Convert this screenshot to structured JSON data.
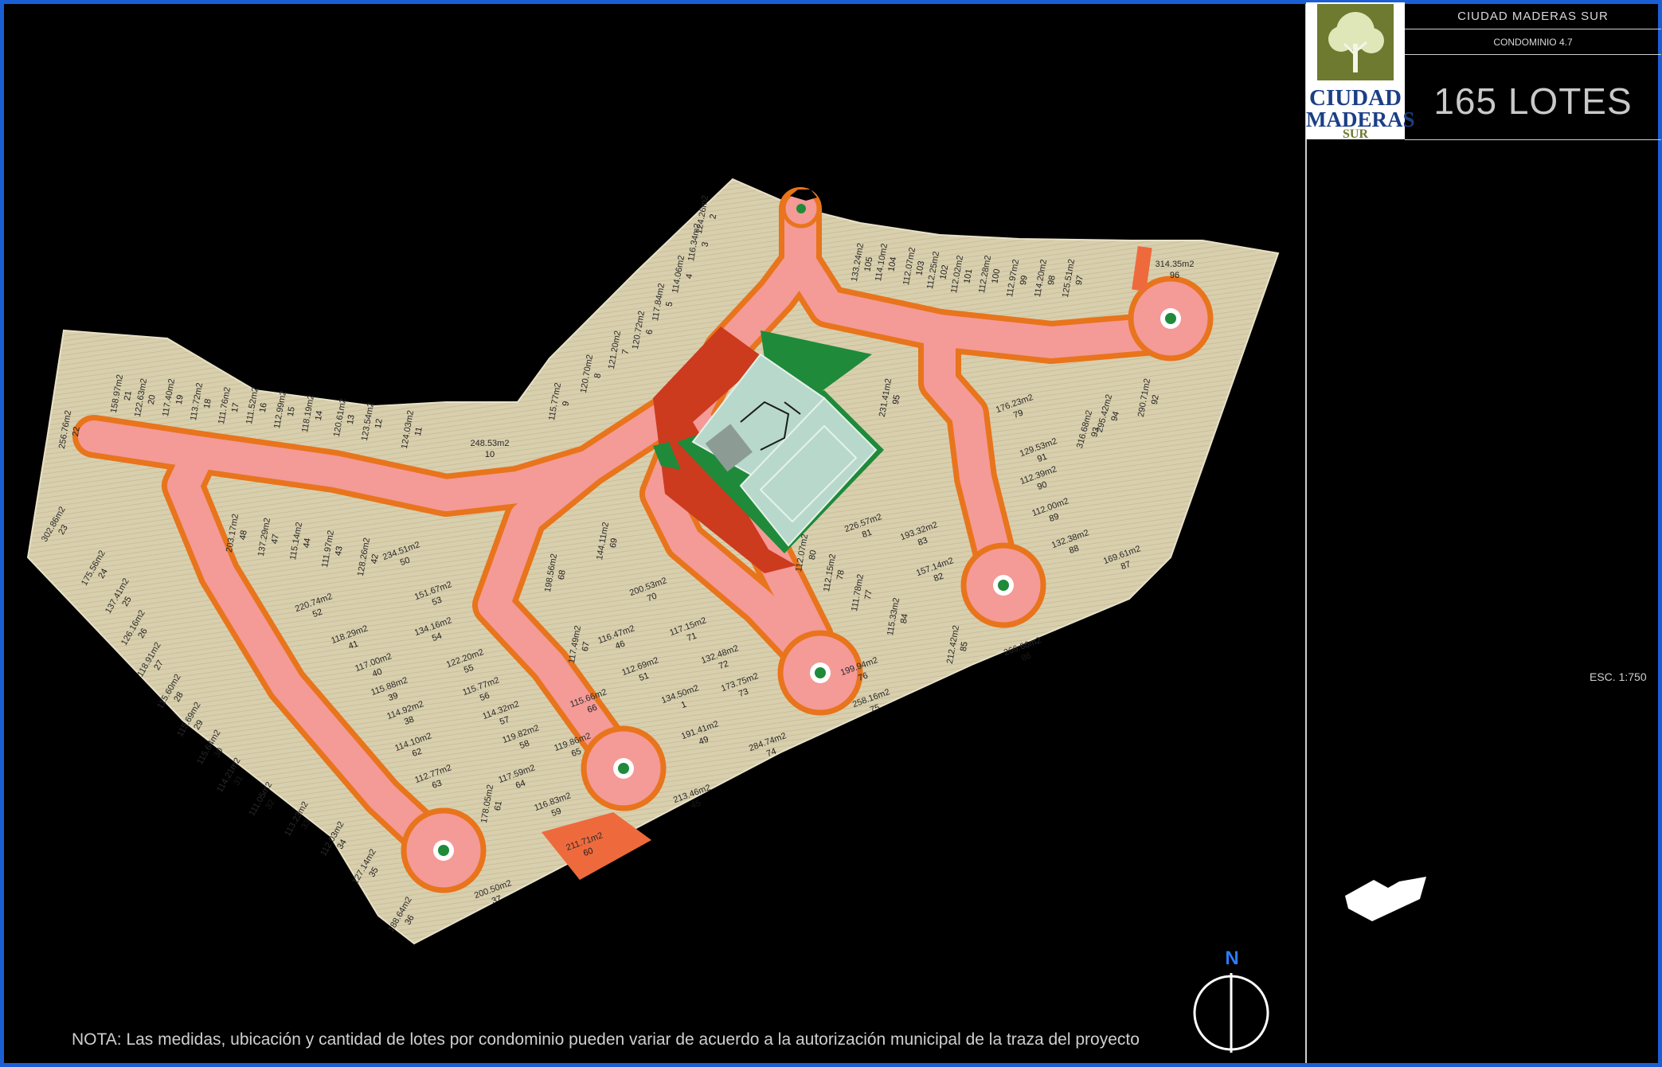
{
  "header": {
    "development_name": "CIUDAD MADERAS SUR",
    "condominium": "CONDOMINIO 4.7",
    "lot_count_label": "165 LOTES"
  },
  "logo": {
    "line1": "CIUDAD",
    "line2": "MADERAS",
    "line3": "SUR"
  },
  "scale_label": "ESC. 1:750",
  "north_label": "N",
  "note": "NOTA: Las medidas, ubicación y cantidad de lotes por condominio pueden variar de acuerdo a la autorización municipal de la traza del proyecto",
  "colors": {
    "background": "#000000",
    "frame": "#1b5fd6",
    "lot_fill": "#d8cfae",
    "road_fill": "#f49a97",
    "road_edge": "#e8741c",
    "green_area": "#1f8a3a",
    "amenity": "#b8d8cc",
    "commercial": "#cc3b1e",
    "special_lot": "#ee6a3c"
  },
  "lots": [
    {
      "number": "10",
      "area": "248.53m2"
    },
    {
      "number": "94",
      "area": "295.42m2"
    },
    {
      "number": "96",
      "area": "314.35m2"
    },
    {
      "number": "60",
      "area": "211.71m2"
    },
    {
      "number": "36",
      "area": "188.64m2"
    },
    {
      "number": "37",
      "area": "200.50m2"
    },
    {
      "number": "75",
      "area": "258.16m2"
    },
    {
      "number": "86",
      "area": "266.66m2"
    },
    {
      "number": "22",
      "area": "256.76m2"
    },
    {
      "number": "93",
      "area": "316.68m2"
    },
    {
      "number": "79",
      "area": "176.23m2"
    },
    {
      "number": "105",
      "area": "133.24m2"
    },
    {
      "number": "104",
      "area": "114.10m2"
    },
    {
      "number": "103",
      "area": "112.07m2"
    },
    {
      "number": "102",
      "area": "112.25m2"
    },
    {
      "number": "101",
      "area": "112.02m2"
    },
    {
      "number": "100",
      "area": "112.28m2"
    },
    {
      "number": "99",
      "area": "112.97m2"
    },
    {
      "number": "98",
      "area": "114.20m2"
    },
    {
      "number": "97",
      "area": "125.51m2"
    },
    {
      "number": "21",
      "area": "158.97m2"
    },
    {
      "number": "20",
      "area": "122.63m2"
    },
    {
      "number": "19",
      "area": "117.40m2"
    },
    {
      "number": "18",
      "area": "113.72m2"
    },
    {
      "number": "17",
      "area": "111.76m2"
    },
    {
      "number": "16",
      "area": "111.52m2"
    },
    {
      "number": "15",
      "area": "112.99m2"
    },
    {
      "number": "14",
      "area": "118.19m2"
    },
    {
      "number": "13",
      "area": "120.61m2"
    },
    {
      "number": "12",
      "area": "123.54m2"
    },
    {
      "number": "11",
      "area": "124.03m2"
    },
    {
      "number": "2",
      "area": "124.26m2"
    },
    {
      "number": "3",
      "area": "116.34m2"
    },
    {
      "number": "4",
      "area": "114.06m2"
    },
    {
      "number": "5",
      "area": "117.84m2"
    },
    {
      "number": "6",
      "area": "120.72m2"
    },
    {
      "number": "7",
      "area": "121.20m2"
    },
    {
      "number": "8",
      "area": "120.70m2"
    },
    {
      "number": "9",
      "area": "115.77m2"
    },
    {
      "number": "48",
      "area": "203.17m2"
    },
    {
      "number": "47",
      "area": "137.29m2"
    },
    {
      "number": "50",
      "area": "234.51m2"
    },
    {
      "number": "52",
      "area": "220.74m2"
    },
    {
      "number": "53",
      "area": "151.67m2"
    },
    {
      "number": "54",
      "area": "134.16m2"
    },
    {
      "number": "55",
      "area": "122.20m2"
    },
    {
      "number": "56",
      "area": "115.77m2"
    },
    {
      "number": "57",
      "area": "114.32m2"
    },
    {
      "number": "58",
      "area": "119.82m2"
    },
    {
      "number": "59",
      "area": "116.83m2"
    },
    {
      "number": "23",
      "area": "302.86m2"
    },
    {
      "number": "24",
      "area": "175.56m2"
    },
    {
      "number": "25",
      "area": "137.41m2"
    },
    {
      "number": "26",
      "area": "126.16m2"
    },
    {
      "number": "27",
      "area": "118.91m2"
    },
    {
      "number": "28",
      "area": "115.60m2"
    },
    {
      "number": "29",
      "area": "115.69m2"
    },
    {
      "number": "30",
      "area": "115.64m2"
    },
    {
      "number": "31",
      "area": "114.21m2"
    },
    {
      "number": "32",
      "area": "111.05m2"
    },
    {
      "number": "33",
      "area": "113.23m2"
    },
    {
      "number": "34",
      "area": "112.03m2"
    },
    {
      "number": "35",
      "area": "127.14m2"
    },
    {
      "number": "44",
      "area": "115.14m2"
    },
    {
      "number": "43",
      "area": "111.97m2"
    },
    {
      "number": "42",
      "area": "128.26m2"
    },
    {
      "number": "41",
      "area": "118.29m2"
    },
    {
      "number": "40",
      "area": "117.00m2"
    },
    {
      "number": "39",
      "area": "115.88m2"
    },
    {
      "number": "38",
      "area": "114.92m2"
    },
    {
      "number": "61",
      "area": "178.05m2"
    },
    {
      "number": "62",
      "area": "114.10m2"
    },
    {
      "number": "63",
      "area": "112.77m2"
    },
    {
      "number": "64",
      "area": "117.59m2"
    },
    {
      "number": "65",
      "area": "119.86m2"
    },
    {
      "number": "66",
      "area": "115.66m2"
    },
    {
      "number": "67",
      "area": "117.49m2"
    },
    {
      "number": "68",
      "area": "198.56m2"
    },
    {
      "number": "69",
      "area": "144.11m2"
    },
    {
      "number": "70",
      "area": "200.53m2"
    },
    {
      "number": "71",
      "area": "117.15m2"
    },
    {
      "number": "72",
      "area": "132.48m2"
    },
    {
      "number": "73",
      "area": "173.75m2"
    },
    {
      "number": "74",
      "area": "284.74m2"
    },
    {
      "number": "76",
      "area": "199.94m2"
    },
    {
      "number": "77",
      "area": "111.78m2"
    },
    {
      "number": "78",
      "area": "112.15m2"
    },
    {
      "number": "80",
      "area": "112.07m2"
    },
    {
      "number": "81",
      "area": "226.57m2"
    },
    {
      "number": "82",
      "area": "157.14m2"
    },
    {
      "number": "83",
      "area": "193.32m2"
    },
    {
      "number": "84",
      "area": "115.33m2"
    },
    {
      "number": "85",
      "area": "212.42m2"
    },
    {
      "number": "87",
      "area": "169.61m2"
    },
    {
      "number": "88",
      "area": "132.38m2"
    },
    {
      "number": "89",
      "area": "112.00m2"
    },
    {
      "number": "90",
      "area": "112.39m2"
    },
    {
      "number": "91",
      "area": "129.53m2"
    },
    {
      "number": "92",
      "area": "290.71m2"
    },
    {
      "number": "95",
      "area": "231.41m2"
    },
    {
      "number": "1",
      "area": "134.50m2"
    },
    {
      "number": "49",
      "area": "191.41m2"
    },
    {
      "number": "45",
      "area": "213.46m2"
    },
    {
      "number": "51",
      "area": "112.69m2"
    },
    {
      "number": "46",
      "area": "116.47m2"
    }
  ]
}
